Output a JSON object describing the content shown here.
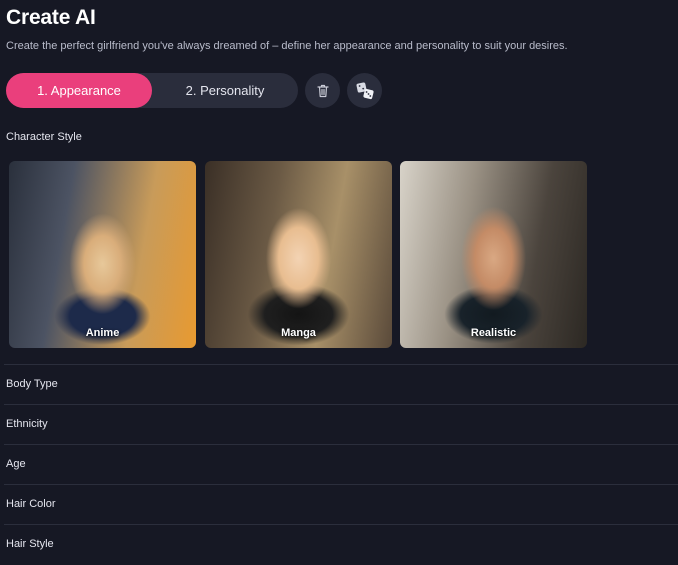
{
  "header": {
    "title": "Create AI",
    "subtitle": "Create the perfect girlfriend you've always dreamed of – define her appearance and personality to suit your desires."
  },
  "tabs": [
    {
      "label": "1. Appearance",
      "active": true
    },
    {
      "label": "2. Personality",
      "active": false
    }
  ],
  "actions": {
    "delete_icon": "trash-icon",
    "randomize_icon": "dice-icon"
  },
  "character_style": {
    "label": "Character Style",
    "options": [
      {
        "label": "Anime"
      },
      {
        "label": "Manga"
      },
      {
        "label": "Realistic"
      }
    ]
  },
  "sections": [
    {
      "label": "Body Type"
    },
    {
      "label": "Ethnicity"
    },
    {
      "label": "Age"
    },
    {
      "label": "Hair Color"
    },
    {
      "label": "Hair Style"
    }
  ],
  "colors": {
    "background": "#161824",
    "accent": "#ea3f7c",
    "control_bg": "#2a2d3c"
  }
}
